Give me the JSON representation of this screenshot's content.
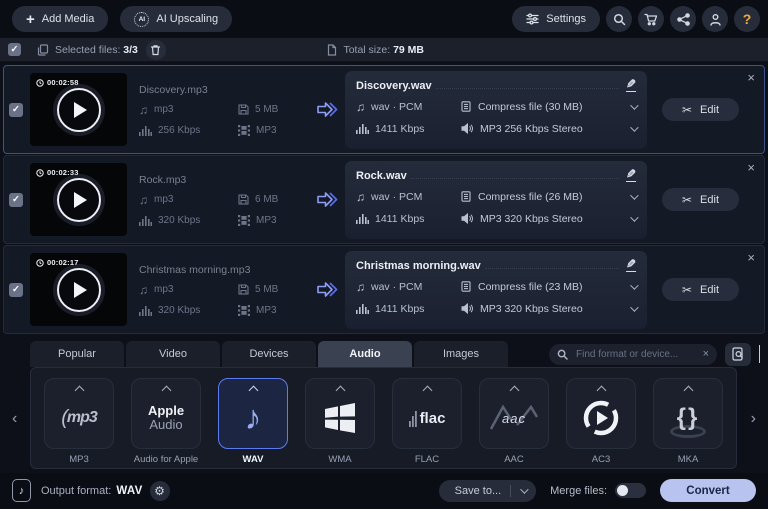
{
  "colors": {
    "accent_blue": "#5d7bf0",
    "convert_bg": "#b9c3ef",
    "help_orange": "#f2a93b",
    "panel_bg": "#141926",
    "active_tab": "#3a4150"
  },
  "icons": {
    "plus": "+",
    "ai": "AI",
    "help": "?",
    "check": "✓",
    "close": "×",
    "pencil": "✎",
    "scissors": "✂",
    "gear": "⚙",
    "note": "♫",
    "note_single": "♪",
    "chevron_left": "‹",
    "chevron_right": "›",
    "braces": "{}"
  },
  "topbar": {
    "add_media": "Add Media",
    "ai_upscaling": "AI Upscaling",
    "settings": "Settings"
  },
  "selection_bar": {
    "selected_label": "Selected files:",
    "selected_value": "3/3",
    "total_label": "Total size:",
    "total_value": "79 MB"
  },
  "files": [
    {
      "duration": "00:02:58",
      "source_name": "Discovery.mp3",
      "source_format": "mp3",
      "source_size": "5 MB",
      "source_bitrate": "256 Kbps",
      "source_codec": "MP3",
      "output_name": "Discovery.wav",
      "output_format": "wav · PCM",
      "compress": "Compress file (30 MB)",
      "output_bitrate": "1411 Kbps",
      "audio": "MP3 256 Kbps Stereo",
      "edit": "Edit"
    },
    {
      "duration": "00:02:33",
      "source_name": "Rock.mp3",
      "source_format": "mp3",
      "source_size": "6 MB",
      "source_bitrate": "320 Kbps",
      "source_codec": "MP3",
      "output_name": "Rock.wav",
      "output_format": "wav · PCM",
      "compress": "Compress file (26 MB)",
      "output_bitrate": "1411 Kbps",
      "audio": "MP3 320 Kbps Stereo",
      "edit": "Edit"
    },
    {
      "duration": "00:02:17",
      "source_name": "Christmas morning.mp3",
      "source_format": "mp3",
      "source_size": "5 MB",
      "source_bitrate": "320 Kbps",
      "source_codec": "MP3",
      "output_name": "Christmas morning.wav",
      "output_format": "wav · PCM",
      "compress": "Compress file (23 MB)",
      "output_bitrate": "1411 Kbps",
      "audio": "MP3 320 Kbps Stereo",
      "edit": "Edit"
    }
  ],
  "tabs": [
    {
      "label": "Popular"
    },
    {
      "label": "Video"
    },
    {
      "label": "Devices"
    },
    {
      "label": "Audio",
      "active": true
    },
    {
      "label": "Images"
    }
  ],
  "search": {
    "placeholder": "Find format or device...",
    "clear": "×"
  },
  "formats": [
    {
      "label": "MP3",
      "logo_text": "mp3"
    },
    {
      "label": "Audio for Apple",
      "logo_line1": "Apple",
      "logo_line2": "Audio"
    },
    {
      "label": "WAV",
      "selected": true
    },
    {
      "label": "WMA"
    },
    {
      "label": "FLAC",
      "logo_text": "flac"
    },
    {
      "label": "AAC",
      "logo_text": "aac"
    },
    {
      "label": "AC3"
    },
    {
      "label": "MKA",
      "logo_text": "{}"
    }
  ],
  "footer": {
    "output_format_label": "Output format:",
    "output_format_value": "WAV",
    "save_to": "Save to...",
    "merge_label": "Merge files:",
    "convert": "Convert"
  }
}
